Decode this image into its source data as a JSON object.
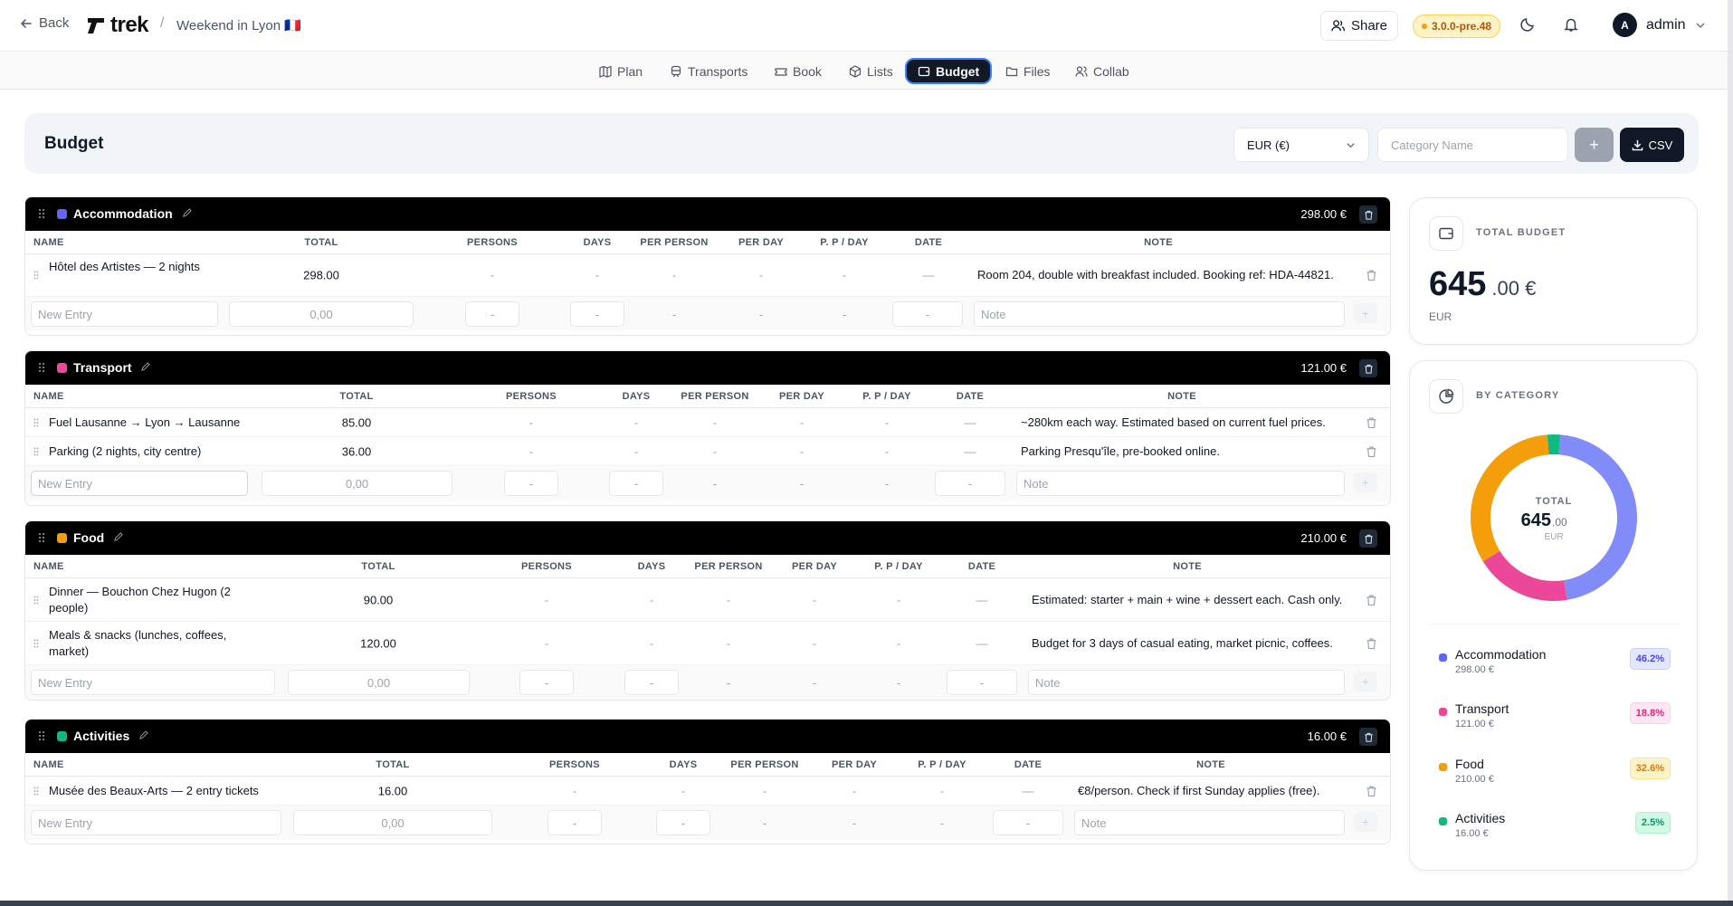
{
  "header": {
    "back_label": "Back",
    "logo_text": "trek",
    "separator": "/",
    "trip_name": "Weekend in Lyon 🇫🇷",
    "share_label": "Share",
    "version": "3.0.0-pre.48",
    "user_initial": "A",
    "user_name": "admin"
  },
  "tabs": [
    {
      "label": "Plan",
      "icon": "map-icon"
    },
    {
      "label": "Transports",
      "icon": "train-icon"
    },
    {
      "label": "Book",
      "icon": "ticket-icon"
    },
    {
      "label": "Lists",
      "icon": "package-icon"
    },
    {
      "label": "Budget",
      "icon": "wallet-icon",
      "active": true
    },
    {
      "label": "Files",
      "icon": "folder-icon"
    },
    {
      "label": "Collab",
      "icon": "users-icon"
    }
  ],
  "budget_header": {
    "title": "Budget",
    "currency": "EUR (€)",
    "category_placeholder": "Category Name",
    "add_label": "+",
    "csv_label": "CSV"
  },
  "columns": [
    "NAME",
    "TOTAL",
    "PERSONS",
    "DAYS",
    "PER PERSON",
    "PER DAY",
    "P. P / DAY",
    "DATE",
    "NOTE"
  ],
  "new_entry": {
    "name_placeholder": "New Entry",
    "total_placeholder": "0,00",
    "dash": "-",
    "note_placeholder": "Note"
  },
  "categories": [
    {
      "name": "Accommodation",
      "color": "#6366f1",
      "total": "298.00 €",
      "items": [
        {
          "name": "Hôtel des Artistes — 2 nights",
          "total": "298.00",
          "persons": "-",
          "days": "-",
          "per_person": "-",
          "per_day": "-",
          "ppd": "-",
          "date": "—",
          "note": "Room 204, double with breakfast included. Booking ref: HDA-44821."
        }
      ]
    },
    {
      "name": "Transport",
      "color": "#ec4899",
      "total": "121.00 €",
      "items": [
        {
          "name": "Fuel Lausanne → Lyon → Lausanne",
          "total": "85.00",
          "persons": "-",
          "days": "-",
          "per_person": "-",
          "per_day": "-",
          "ppd": "-",
          "date": "—",
          "note": "~280km each way. Estimated based on current fuel prices."
        },
        {
          "name": "Parking (2 nights, city centre)",
          "total": "36.00",
          "persons": "-",
          "days": "-",
          "per_person": "-",
          "per_day": "-",
          "ppd": "-",
          "date": "—",
          "note": "Parking Presqu'île, pre-booked online."
        }
      ]
    },
    {
      "name": "Food",
      "color": "#f59e0b",
      "total": "210.00 €",
      "items": [
        {
          "name": "Dinner — Bouchon Chez Hugon (2 people)",
          "total": "90.00",
          "persons": "-",
          "days": "-",
          "per_person": "-",
          "per_day": "-",
          "ppd": "-",
          "date": "—",
          "note": "Estimated: starter + main + wine + dessert each. Cash only."
        },
        {
          "name": "Meals & snacks (lunches, coffees, market)",
          "total": "120.00",
          "persons": "-",
          "days": "-",
          "per_person": "-",
          "per_day": "-",
          "ppd": "-",
          "date": "—",
          "note": "Budget for 3 days of casual eating, market picnic, coffees."
        }
      ]
    },
    {
      "name": "Activities",
      "color": "#10b981",
      "total": "16.00 €",
      "items": [
        {
          "name": "Musée des Beaux-Arts — 2 entry tickets",
          "total": "16.00",
          "persons": "-",
          "days": "-",
          "per_person": "-",
          "per_day": "-",
          "ppd": "-",
          "date": "—",
          "note": "€8/person. Check if first Sunday applies (free)."
        }
      ]
    }
  ],
  "total_card": {
    "label": "TOTAL BUDGET",
    "integer": "645",
    "decimal": ".00 €",
    "currency": "EUR"
  },
  "category_card": {
    "label": "BY CATEGORY",
    "center_label": "TOTAL",
    "center_integer": "645",
    "center_decimal": ".00",
    "center_currency": "EUR"
  },
  "chart_data": {
    "type": "pie",
    "donut": true,
    "categories": [
      "Accommodation",
      "Transport",
      "Food",
      "Activities"
    ],
    "values": [
      298.0,
      121.0,
      210.0,
      16.0
    ],
    "value_labels": [
      "298.00 €",
      "121.00 €",
      "210.00 €",
      "16.00 €"
    ],
    "percent_labels": [
      "46.2%",
      "18.8%",
      "32.6%",
      "2.5%"
    ],
    "colors": [
      "#818cf8",
      "#ec4899",
      "#f59e0b",
      "#10b981"
    ],
    "badge_bg": [
      "#e0e7ff",
      "#fce7f3",
      "#fef3c7",
      "#d1fae5"
    ],
    "badge_fg": [
      "#4f46e5",
      "#db2777",
      "#d97706",
      "#059669"
    ]
  }
}
